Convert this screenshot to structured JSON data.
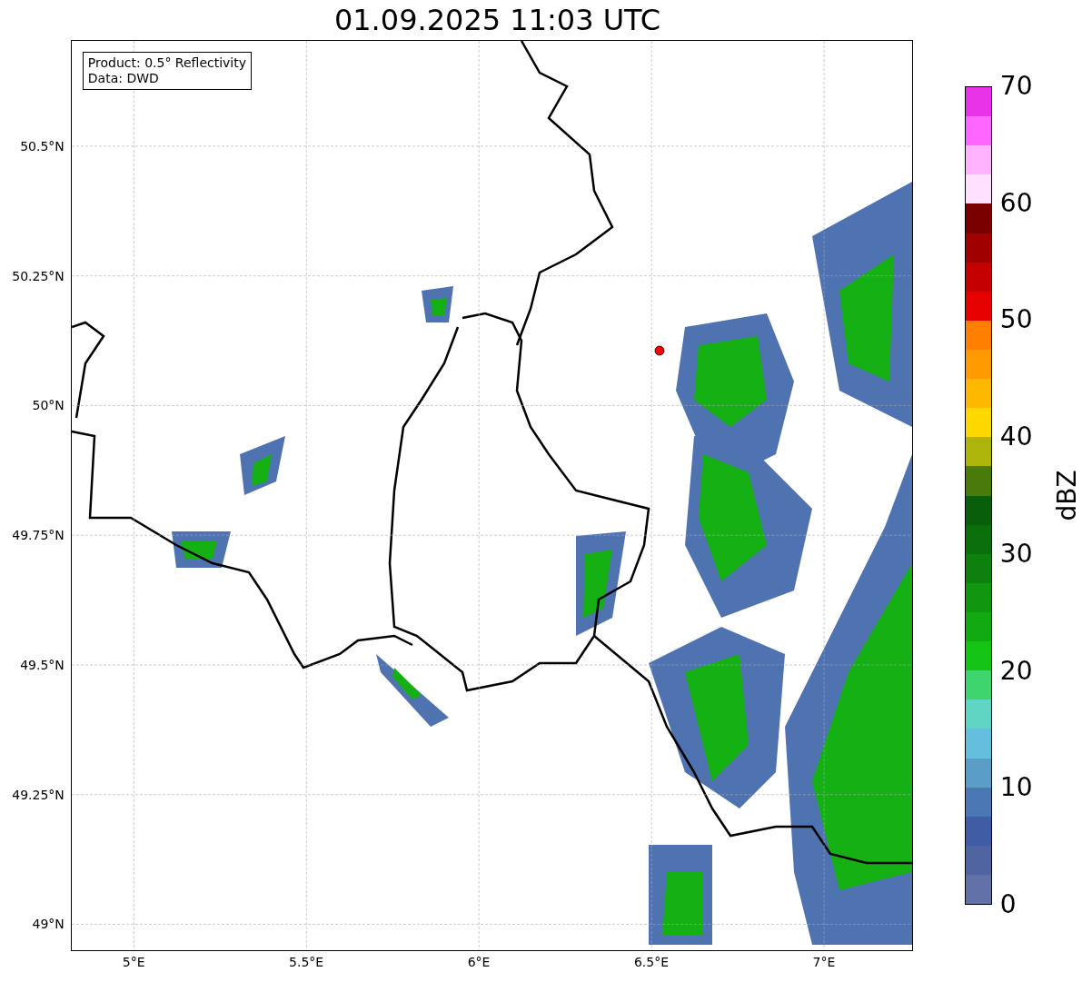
{
  "title": "01.09.2025 11:03 UTC",
  "info_box": {
    "lines": [
      "Product: 0.5° Reflectivity",
      "Data: DWD"
    ]
  },
  "map": {
    "xticks": [
      "5°E",
      "5.5°E",
      "6°E",
      "6.5°E",
      "7°E"
    ],
    "yticks": [
      "50.5°N",
      "50.25°N",
      "50°N",
      "49.75°N",
      "49.5°N",
      "49.25°N",
      "49°N"
    ]
  },
  "colorbar": {
    "label": "dBZ",
    "ticks": [
      "70",
      "60",
      "50",
      "40",
      "30",
      "20",
      "10",
      "0"
    ],
    "bins": [
      {
        "color": "#e833e8"
      },
      {
        "color": "#ff66ff"
      },
      {
        "color": "#ffb3ff"
      },
      {
        "color": "#ffe0ff"
      },
      {
        "color": "#7a0000"
      },
      {
        "color": "#a00000"
      },
      {
        "color": "#c40000"
      },
      {
        "color": "#e60000"
      },
      {
        "color": "#ff7f00"
      },
      {
        "color": "#ff9a00"
      },
      {
        "color": "#ffb800"
      },
      {
        "color": "#ffd800"
      },
      {
        "color": "#adb50a"
      },
      {
        "color": "#4a7a0a"
      },
      {
        "color": "#085e0a"
      },
      {
        "color": "#0a6e0a"
      },
      {
        "color": "#0e800e"
      },
      {
        "color": "#10960f"
      },
      {
        "color": "#12aa12"
      },
      {
        "color": "#14c414"
      },
      {
        "color": "#3ed46e"
      },
      {
        "color": "#5fd6c4"
      },
      {
        "color": "#64bedd"
      },
      {
        "color": "#5a9ec8"
      },
      {
        "color": "#4a78b4"
      },
      {
        "color": "#3f5ca4"
      },
      {
        "color": "#4f64a0"
      },
      {
        "color": "#6272a8"
      }
    ]
  }
}
